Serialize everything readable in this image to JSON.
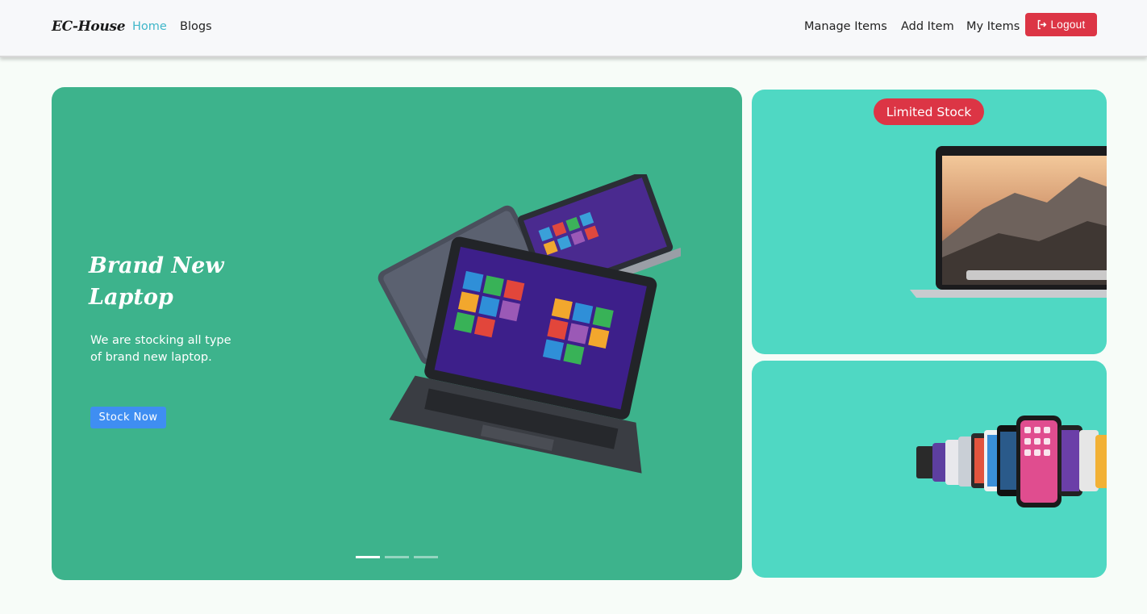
{
  "navbar": {
    "brand": "EC-House",
    "links_left": [
      {
        "label": "Home",
        "active": true
      },
      {
        "label": "Blogs",
        "active": false
      }
    ],
    "links_right": [
      {
        "label": "Manage Items"
      },
      {
        "label": "Add Item"
      },
      {
        "label": "My Items"
      }
    ],
    "logout_label": "Logout"
  },
  "hero": {
    "title": "Brand New Laptop",
    "text": "We are stocking all type of brand new laptop.",
    "button_label": "Stock Now",
    "slides_total": 3,
    "active_slide": 1
  },
  "side_cards": {
    "top_badge": "Limited Stock"
  },
  "icons": [
    "logout-icon",
    "laptop-image",
    "macbook-image",
    "smartphones-image"
  ],
  "colors": {
    "accent_link": "#3fb6c9",
    "danger": "#dc3545",
    "hero_bg": "#3db38c",
    "card_bg": "#4fd8c3",
    "primary_button": "#3f8ef2"
  }
}
